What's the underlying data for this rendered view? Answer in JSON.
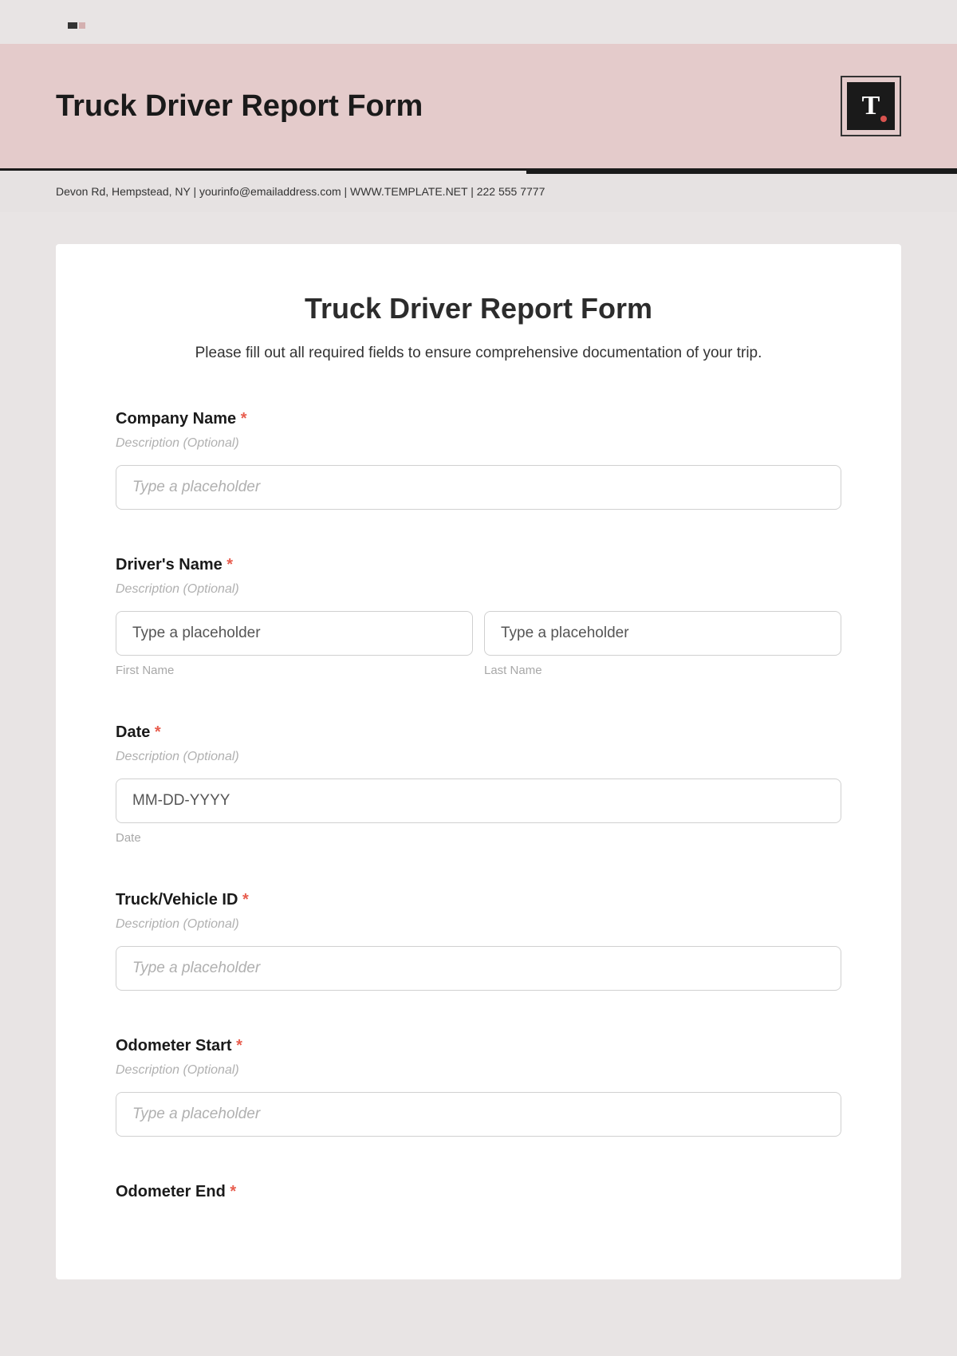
{
  "header": {
    "title": "Truck Driver Report Form",
    "contact_line": "Devon Rd, Hempstead, NY | yourinfo@emailaddress.com | WWW.TEMPLATE.NET | 222 555 7777"
  },
  "form": {
    "title": "Truck Driver Report Form",
    "intro": "Please fill out all required fields to ensure comprehensive documentation of your trip."
  },
  "fields": {
    "company": {
      "label": "Company Name",
      "required_marker": "*",
      "desc": "Description (Optional)",
      "placeholder": "Type a placeholder"
    },
    "driver": {
      "label": "Driver's Name",
      "required_marker": "*",
      "desc": "Description (Optional)",
      "first_placeholder": "Type a placeholder",
      "last_placeholder": "Type a placeholder",
      "first_sub": "First Name",
      "last_sub": "Last Name"
    },
    "date": {
      "label": "Date",
      "required_marker": "*",
      "desc": "Description (Optional)",
      "placeholder": "MM-DD-YYYY",
      "sub": "Date"
    },
    "vehicle": {
      "label": "Truck/Vehicle ID",
      "required_marker": "*",
      "desc": "Description (Optional)",
      "placeholder": "Type a placeholder"
    },
    "odo_start": {
      "label": "Odometer Start",
      "required_marker": "*",
      "desc": "Description (Optional)",
      "placeholder": "Type a placeholder"
    },
    "odo_end": {
      "label": "Odometer End",
      "required_marker": "*"
    }
  },
  "logo": {
    "letter": "T"
  }
}
